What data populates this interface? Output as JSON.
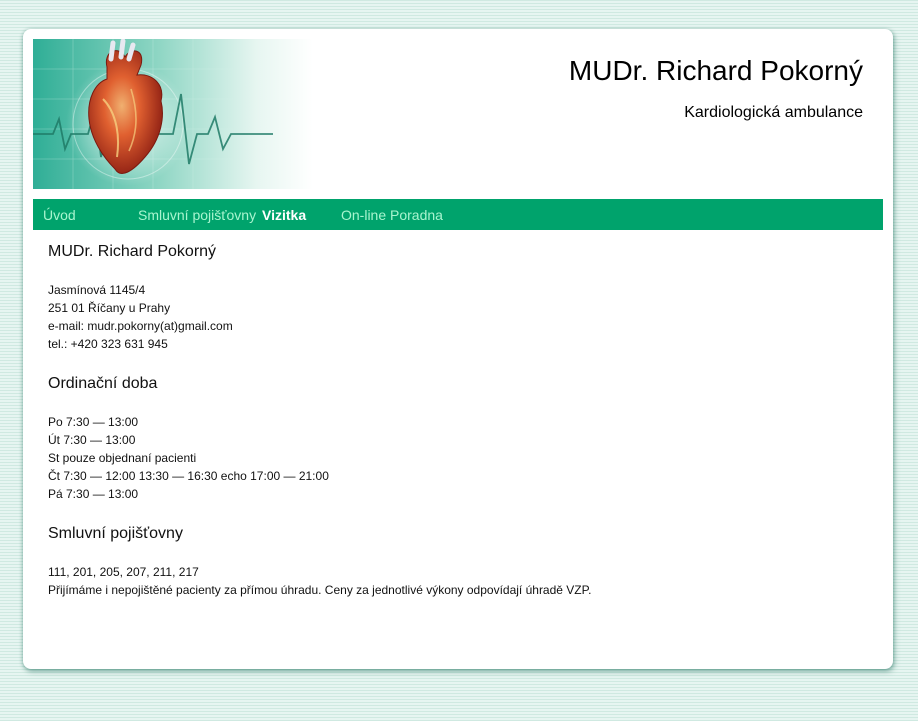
{
  "header": {
    "title": "MUDr. Richard Pokorný",
    "subtitle": "Kardiologická ambulance",
    "banner_image": "heart-illustration-with-ekg"
  },
  "nav": {
    "items": [
      {
        "label": "Úvod",
        "active": false
      },
      {
        "label": "Smluvní pojišťovny",
        "active": false
      },
      {
        "label": "Vizitka",
        "active": true
      },
      {
        "label": "On-line Poradna",
        "active": false
      }
    ]
  },
  "contact": {
    "heading": "MUDr. Richard Pokorný",
    "lines": [
      "Jasmínová 1145/4",
      "251 01 Říčany u Prahy",
      "e-mail: mudr.pokorny(at)gmail.com",
      "tel.: +420 323 631 945"
    ]
  },
  "hours": {
    "heading": "Ordinační doba",
    "lines": [
      "Po 7:30 — 13:00",
      "Út 7:30 — 13:00",
      "St pouze objednaní pacienti",
      "Čt 7:30 — 12:00 13:30 — 16:30 echo 17:00 — 21:00",
      "Pá 7:30 — 13:00"
    ]
  },
  "insurance": {
    "heading": "Smluvní pojišťovny",
    "lines": [
      "111, 201, 205, 207, 211, 217",
      "Přijímáme i nepojištěné pacienty za přímou úhradu. Ceny za jednotlivé výkony odpovídají úhradě VZP."
    ]
  },
  "colors": {
    "nav_background": "#00a36c",
    "nav_link": "#a8f5cf",
    "nav_link_active": "#ffffff",
    "page_background": "#d8efe8"
  }
}
